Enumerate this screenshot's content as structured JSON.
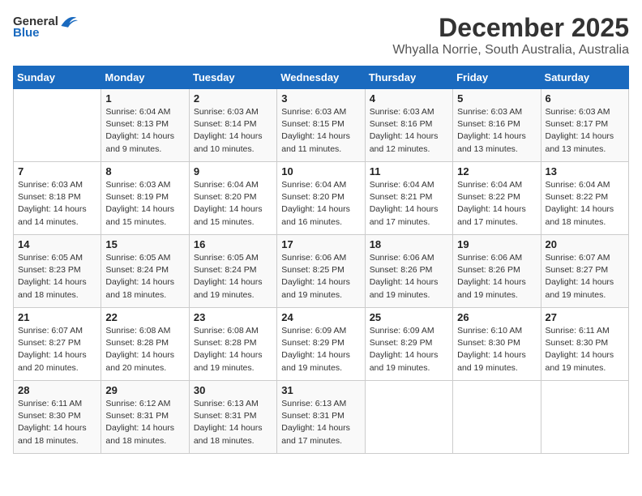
{
  "header": {
    "logo_general": "General",
    "logo_blue": "Blue",
    "month_year": "December 2025",
    "location": "Whyalla Norrie, South Australia, Australia"
  },
  "days_of_week": [
    "Sunday",
    "Monday",
    "Tuesday",
    "Wednesday",
    "Thursday",
    "Friday",
    "Saturday"
  ],
  "weeks": [
    [
      {
        "day": "",
        "details": ""
      },
      {
        "day": "1",
        "details": "Sunrise: 6:04 AM\nSunset: 8:13 PM\nDaylight: 14 hours\nand 9 minutes."
      },
      {
        "day": "2",
        "details": "Sunrise: 6:03 AM\nSunset: 8:14 PM\nDaylight: 14 hours\nand 10 minutes."
      },
      {
        "day": "3",
        "details": "Sunrise: 6:03 AM\nSunset: 8:15 PM\nDaylight: 14 hours\nand 11 minutes."
      },
      {
        "day": "4",
        "details": "Sunrise: 6:03 AM\nSunset: 8:16 PM\nDaylight: 14 hours\nand 12 minutes."
      },
      {
        "day": "5",
        "details": "Sunrise: 6:03 AM\nSunset: 8:16 PM\nDaylight: 14 hours\nand 13 minutes."
      },
      {
        "day": "6",
        "details": "Sunrise: 6:03 AM\nSunset: 8:17 PM\nDaylight: 14 hours\nand 13 minutes."
      }
    ],
    [
      {
        "day": "7",
        "details": "Sunrise: 6:03 AM\nSunset: 8:18 PM\nDaylight: 14 hours\nand 14 minutes."
      },
      {
        "day": "8",
        "details": "Sunrise: 6:03 AM\nSunset: 8:19 PM\nDaylight: 14 hours\nand 15 minutes."
      },
      {
        "day": "9",
        "details": "Sunrise: 6:04 AM\nSunset: 8:20 PM\nDaylight: 14 hours\nand 15 minutes."
      },
      {
        "day": "10",
        "details": "Sunrise: 6:04 AM\nSunset: 8:20 PM\nDaylight: 14 hours\nand 16 minutes."
      },
      {
        "day": "11",
        "details": "Sunrise: 6:04 AM\nSunset: 8:21 PM\nDaylight: 14 hours\nand 17 minutes."
      },
      {
        "day": "12",
        "details": "Sunrise: 6:04 AM\nSunset: 8:22 PM\nDaylight: 14 hours\nand 17 minutes."
      },
      {
        "day": "13",
        "details": "Sunrise: 6:04 AM\nSunset: 8:22 PM\nDaylight: 14 hours\nand 18 minutes."
      }
    ],
    [
      {
        "day": "14",
        "details": "Sunrise: 6:05 AM\nSunset: 8:23 PM\nDaylight: 14 hours\nand 18 minutes."
      },
      {
        "day": "15",
        "details": "Sunrise: 6:05 AM\nSunset: 8:24 PM\nDaylight: 14 hours\nand 18 minutes."
      },
      {
        "day": "16",
        "details": "Sunrise: 6:05 AM\nSunset: 8:24 PM\nDaylight: 14 hours\nand 19 minutes."
      },
      {
        "day": "17",
        "details": "Sunrise: 6:06 AM\nSunset: 8:25 PM\nDaylight: 14 hours\nand 19 minutes."
      },
      {
        "day": "18",
        "details": "Sunrise: 6:06 AM\nSunset: 8:26 PM\nDaylight: 14 hours\nand 19 minutes."
      },
      {
        "day": "19",
        "details": "Sunrise: 6:06 AM\nSunset: 8:26 PM\nDaylight: 14 hours\nand 19 minutes."
      },
      {
        "day": "20",
        "details": "Sunrise: 6:07 AM\nSunset: 8:27 PM\nDaylight: 14 hours\nand 19 minutes."
      }
    ],
    [
      {
        "day": "21",
        "details": "Sunrise: 6:07 AM\nSunset: 8:27 PM\nDaylight: 14 hours\nand 20 minutes."
      },
      {
        "day": "22",
        "details": "Sunrise: 6:08 AM\nSunset: 8:28 PM\nDaylight: 14 hours\nand 20 minutes."
      },
      {
        "day": "23",
        "details": "Sunrise: 6:08 AM\nSunset: 8:28 PM\nDaylight: 14 hours\nand 19 minutes."
      },
      {
        "day": "24",
        "details": "Sunrise: 6:09 AM\nSunset: 8:29 PM\nDaylight: 14 hours\nand 19 minutes."
      },
      {
        "day": "25",
        "details": "Sunrise: 6:09 AM\nSunset: 8:29 PM\nDaylight: 14 hours\nand 19 minutes."
      },
      {
        "day": "26",
        "details": "Sunrise: 6:10 AM\nSunset: 8:30 PM\nDaylight: 14 hours\nand 19 minutes."
      },
      {
        "day": "27",
        "details": "Sunrise: 6:11 AM\nSunset: 8:30 PM\nDaylight: 14 hours\nand 19 minutes."
      }
    ],
    [
      {
        "day": "28",
        "details": "Sunrise: 6:11 AM\nSunset: 8:30 PM\nDaylight: 14 hours\nand 18 minutes."
      },
      {
        "day": "29",
        "details": "Sunrise: 6:12 AM\nSunset: 8:31 PM\nDaylight: 14 hours\nand 18 minutes."
      },
      {
        "day": "30",
        "details": "Sunrise: 6:13 AM\nSunset: 8:31 PM\nDaylight: 14 hours\nand 18 minutes."
      },
      {
        "day": "31",
        "details": "Sunrise: 6:13 AM\nSunset: 8:31 PM\nDaylight: 14 hours\nand 17 minutes."
      },
      {
        "day": "",
        "details": ""
      },
      {
        "day": "",
        "details": ""
      },
      {
        "day": "",
        "details": ""
      }
    ]
  ]
}
